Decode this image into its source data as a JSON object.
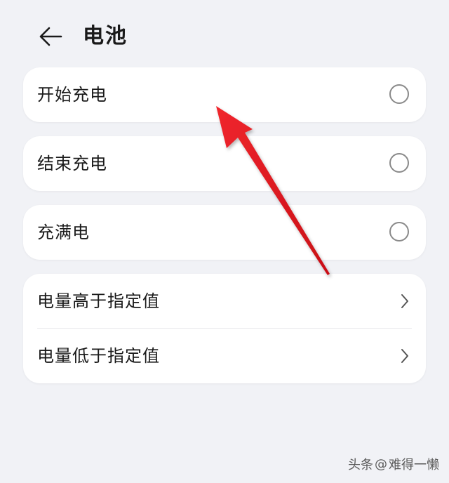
{
  "header": {
    "title": "电池",
    "back_icon": "arrow-left-icon"
  },
  "options": [
    {
      "label": "开始充电",
      "control": "radio",
      "selected": false
    },
    {
      "label": "结束充电",
      "control": "radio",
      "selected": false
    },
    {
      "label": "充满电",
      "control": "radio",
      "selected": false
    }
  ],
  "level_group": {
    "items": [
      {
        "label": "电量高于指定值",
        "icon": "chevron-right-icon"
      },
      {
        "label": "电量低于指定值",
        "icon": "chevron-right-icon"
      }
    ]
  },
  "watermark": {
    "prefix": "头条",
    "at": "@",
    "author": "难得一懒"
  },
  "colors": {
    "background": "#f1f2f6",
    "card": "#ffffff",
    "annotation_arrow": "#e0151d"
  }
}
